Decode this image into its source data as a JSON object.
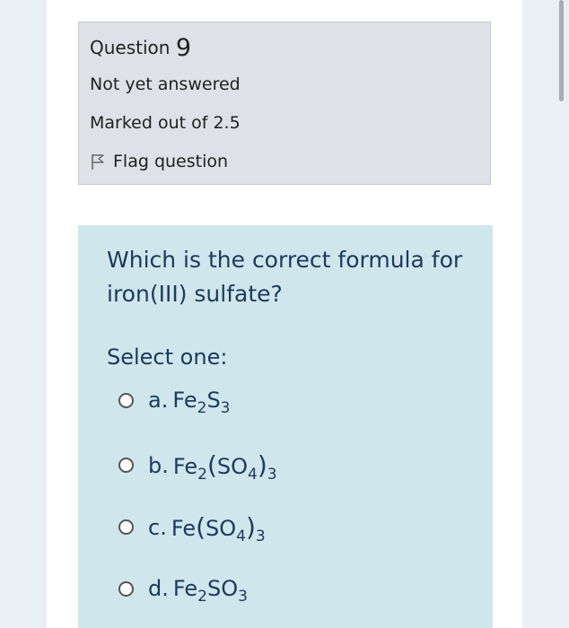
{
  "question": {
    "label": "Question",
    "number": "9",
    "status": "Not yet answered",
    "marks": "Marked out of 2.5",
    "flag_label": "Flag question",
    "text": "Which is the correct formula for iron(III) sulfate?",
    "prompt": "Select one:"
  },
  "options": [
    {
      "letter": "a.",
      "p": [
        "Fe",
        "2",
        "S",
        "3"
      ]
    },
    {
      "letter": "b.",
      "p": [
        "Fe",
        "2",
        "(",
        "SO",
        "4",
        ")",
        "3"
      ]
    },
    {
      "letter": "c.",
      "p": [
        "Fe",
        "(",
        "SO",
        "4",
        ")",
        "3"
      ]
    },
    {
      "letter": "d.",
      "p": [
        "Fe",
        "2",
        "SO",
        "3"
      ]
    }
  ],
  "icons": {
    "flag": "flag-icon",
    "radio": "radio-icon"
  },
  "colors": {
    "info_background": "#dee2e6",
    "question_background": "#cfe6ec",
    "question_text": "#1c3a5c"
  }
}
